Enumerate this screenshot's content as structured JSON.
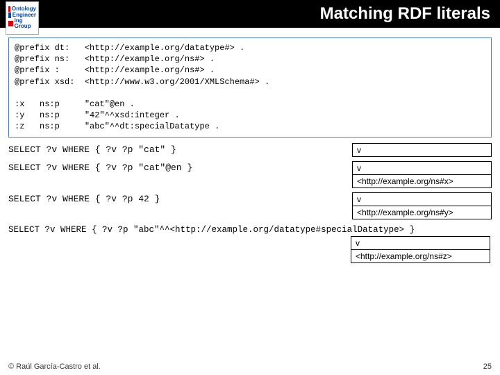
{
  "header": {
    "title": "Matching RDF literals"
  },
  "logo": {
    "l1": "Ontology",
    "l2": "Engineer",
    "l3": "ing Group"
  },
  "code": {
    "block": "@prefix dt:   <http://example.org/datatype#> .\n@prefix ns:   <http://example.org/ns#> .\n@prefix :     <http://example.org/ns#> .\n@prefix xsd:  <http://www.w3.org/2001/XMLSchema#> .\n\n:x   ns:p     \"cat\"@en .\n:y   ns:p     \"42\"^^xsd:integer .\n:z   ns:p     \"abc\"^^dt:specialDatatype ."
  },
  "queries": {
    "q1": {
      "text": "SELECT ?v WHERE { ?v ?p \"cat\" }",
      "head": "v"
    },
    "q2": {
      "text": "SELECT ?v WHERE { ?v ?p \"cat\"@en }",
      "head": "v",
      "row": "<http://example.org/ns#x>"
    },
    "q3": {
      "text": "SELECT ?v WHERE { ?v ?p 42 }",
      "head": "v",
      "row": "<http://example.org/ns#y>"
    },
    "q4": {
      "text": "SELECT ?v WHERE { ?v ?p \"abc\"^^<http://example.org/datatype#specialDatatype> }",
      "head": "v",
      "row": "<http://example.org/ns#z>"
    }
  },
  "footer": {
    "copyright": "© Raúl García-Castro et al.",
    "page": "25"
  }
}
